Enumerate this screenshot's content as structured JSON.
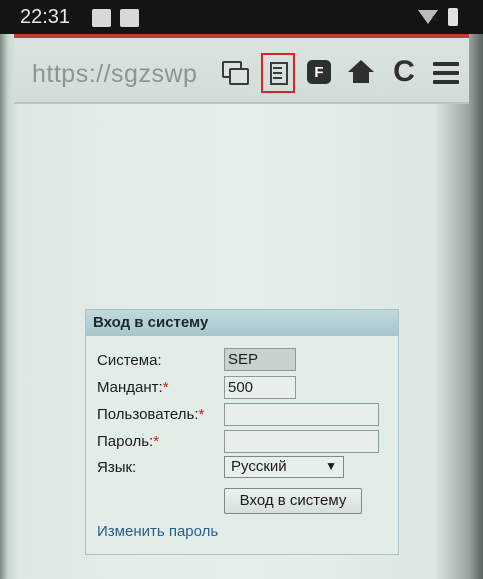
{
  "status_bar": {
    "time": "22:31"
  },
  "browser": {
    "url": "https://sgzswp",
    "icons": [
      "windows-icon",
      "list-icon",
      "f-icon",
      "home-icon",
      "refresh-icon",
      "menu-icon"
    ],
    "f_icon_letter": "F",
    "highlight_color": "#d2282b"
  },
  "login": {
    "title": "Вход в систему",
    "system_label": "Система:",
    "system_value": "SEP",
    "client_label": "Мандант:",
    "client_value": "500",
    "user_label": "Пользователь:",
    "user_value": "",
    "password_label": "Пароль:",
    "password_value": "",
    "required_mark": "*",
    "language_label": "Язык:",
    "language_value": "Русский",
    "login_button": "Вход в систему",
    "change_password_link": "Изменить пароль"
  }
}
